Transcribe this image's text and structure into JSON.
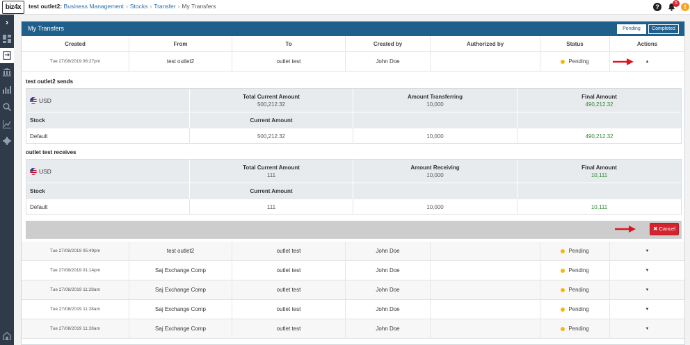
{
  "app": {
    "logo": "biz4x",
    "breadcrumb": {
      "outlet": "test outlet2:",
      "items": [
        "Business Management",
        "Stocks",
        "Transfer"
      ],
      "current": "My Transfers"
    },
    "notifications_count": "5",
    "help_glyph": "?",
    "alert_glyph": "!"
  },
  "sidebar": {
    "toggle_glyph": "›",
    "items": [
      "dashboard-icon",
      "transfer-icon",
      "bank-icon",
      "ledger-icon",
      "search-icon",
      "chart-icon",
      "gear-icon",
      "account-icon"
    ]
  },
  "panel": {
    "title": "My Transfers",
    "filters": {
      "pending": "Pending",
      "completed": "Completed"
    }
  },
  "table": {
    "columns": [
      "Created",
      "From",
      "To",
      "Created by",
      "Authorized by",
      "Status",
      "Actions"
    ],
    "expanded_row": {
      "created": "Tue 27/08/2019 06:27pm",
      "from": "test outlet2",
      "to": "outlet test",
      "created_by": "John Doe",
      "authorized_by": "",
      "status": "Pending",
      "action_glyph": "▲"
    },
    "rows": [
      {
        "created": "Tue 27/08/2019 05:49pm",
        "from": "test outlet2",
        "to": "outlet test",
        "created_by": "John Doe",
        "authorized_by": "",
        "status": "Pending",
        "action_glyph": "▼"
      },
      {
        "created": "Tue 27/08/2019 01:14pm",
        "from": "Saj Exchange Comp",
        "to": "outlet test",
        "created_by": "John Doe",
        "authorized_by": "",
        "status": "Pending",
        "action_glyph": "▼"
      },
      {
        "created": "Tue 27/08/2019 11:28am",
        "from": "Saj Exchange Comp",
        "to": "outlet test",
        "created_by": "John Doe",
        "authorized_by": "",
        "status": "Pending",
        "action_glyph": "▼"
      },
      {
        "created": "Tue 27/08/2019 11:28am",
        "from": "Saj Exchange Comp",
        "to": "outlet test",
        "created_by": "John Doe",
        "authorized_by": "",
        "status": "Pending",
        "action_glyph": "▼"
      },
      {
        "created": "Tue 27/08/2019 11:28am",
        "from": "Saj Exchange Comp",
        "to": "outlet test",
        "created_by": "John Doe",
        "authorized_by": "",
        "status": "Pending",
        "action_glyph": "▼"
      }
    ]
  },
  "details": {
    "sends": {
      "title": "test outlet2 sends",
      "currency": "USD",
      "total_label": "Total Current Amount",
      "total_value": "500,212.32",
      "transfer_label": "Amount Transferring",
      "transfer_value": "10,000",
      "final_label": "Final Amount",
      "final_value": "490,212.32",
      "stock_label": "Stock",
      "current_label": "Current Amount",
      "stock_name": "Default",
      "stock_current": "500,212.32",
      "stock_transfer": "10,000",
      "stock_final": "490,212.32"
    },
    "receives": {
      "title": "outlet test receives",
      "currency": "USD",
      "total_label": "Total Current Amount",
      "total_value": "111",
      "transfer_label": "Amount Receiving",
      "transfer_value": "10,000",
      "final_label": "Final Amount",
      "final_value": "10,111",
      "stock_label": "Stock",
      "current_label": "Current Amount",
      "stock_name": "Default",
      "stock_current": "111",
      "stock_transfer": "10,000",
      "stock_final": "10,111"
    },
    "cancel_label": "Cancel",
    "cancel_glyph": "✖"
  },
  "colors": {
    "header": "#1f5f8b",
    "pending_dot": "#f5b70f",
    "cancel": "#d3252f",
    "final_amount": "#2c8a2c",
    "sidebar": "#2f3b49"
  }
}
